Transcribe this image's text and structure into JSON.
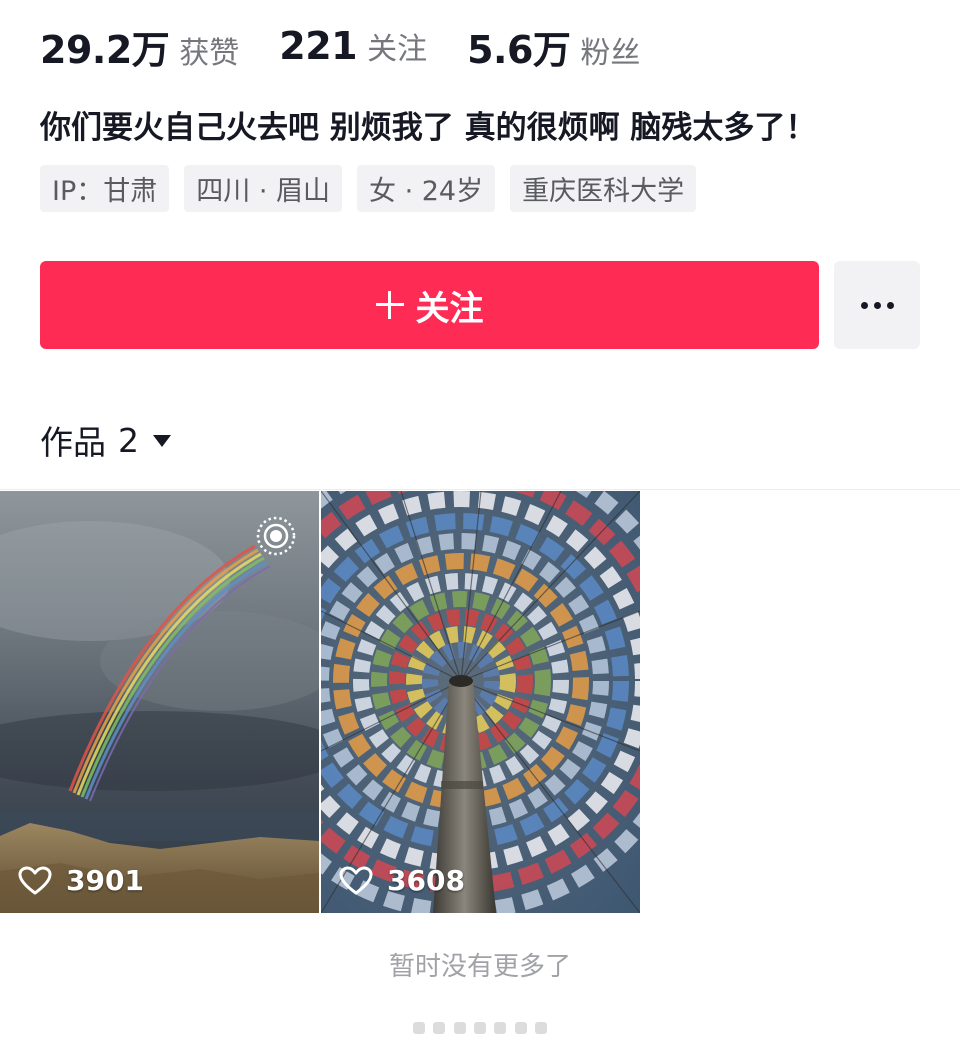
{
  "stats": [
    {
      "value": "29.2万",
      "label": "获赞"
    },
    {
      "value": "221",
      "label": "关注"
    },
    {
      "value": "5.6万",
      "label": "粉丝"
    }
  ],
  "bio": "你们要火自己火去吧 别烦我了 真的很烦啊 脑残太多了！",
  "tags": [
    "IP：甘肃",
    "四川 · 眉山",
    "女 · 24岁",
    "重庆医科大学"
  ],
  "follow_button": {
    "label": "关注",
    "icon": "plus-icon",
    "color": "#fe2c55"
  },
  "more_button": {
    "icon": "more-icon"
  },
  "works": {
    "title": "作品",
    "count": "2",
    "icon": "caret-down-icon"
  },
  "videos": [
    {
      "likes": "3901",
      "subject": "rainbow over hills",
      "badge_icon": "live-photo-icon"
    },
    {
      "likes": "3608",
      "subject": "prayer flags radiating from pole"
    }
  ],
  "footer": {
    "no_more": "暂时没有更多了"
  }
}
